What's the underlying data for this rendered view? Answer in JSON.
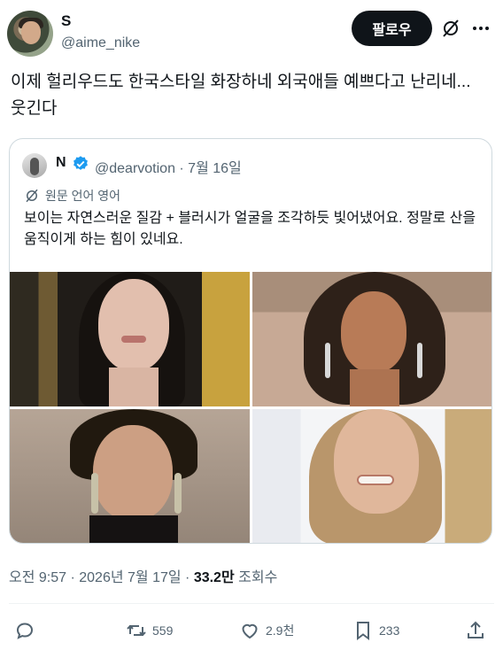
{
  "author": {
    "display_name": "S",
    "handle": "@aime_nike",
    "follow_label": "팔로우"
  },
  "tweet": {
    "text": "이제 헐리우드도 한국스타일 화장하네 외국애들 예쁘다고 난리네... 웃긴다"
  },
  "quote": {
    "author_name": "N",
    "handle_date": "@dearvotion · 7월 16일",
    "translated_label": "원문 언어 영어",
    "text": "보이는 자연스러운 질감 + 블러시가 얼굴을 조각하듯 빛어냈어요. 정말로 산을 움직이게 하는 힘이 있네요.",
    "photos": [
      "photo-1",
      "photo-2",
      "photo-3",
      "photo-4"
    ]
  },
  "meta": {
    "timestamp": "오전 9:57 · 2026년 7월 17일 · ",
    "views_count": "33.2만",
    "views_label": " 조회수"
  },
  "actions": {
    "reply_count": "",
    "retweet_count": "559",
    "like_count": "2.9천",
    "bookmark_count": "233"
  },
  "icons": {
    "verified": "verified-badge-icon",
    "grok": "grok-icon",
    "more": "more-dots-icon",
    "reply": "reply-icon",
    "retweet": "retweet-icon",
    "like": "heart-icon",
    "bookmark": "bookmark-icon",
    "share": "share-icon"
  },
  "colors": {
    "text_primary": "#0f1419",
    "text_secondary": "#536471",
    "follow_bg": "#0f1419",
    "verified_blue": "#1d9bf0",
    "border": "#cfd9de"
  }
}
